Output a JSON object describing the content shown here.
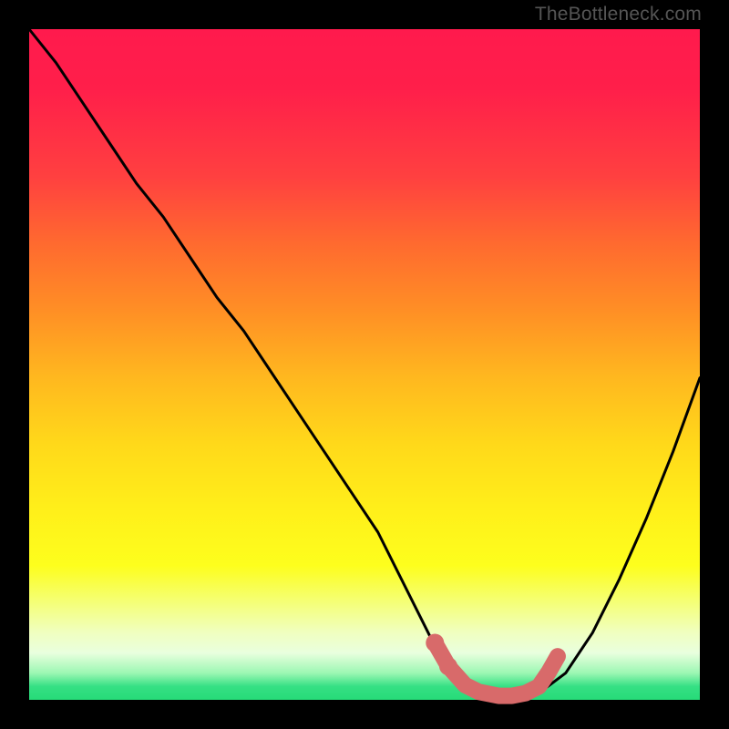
{
  "watermark": "TheBottleneck.com",
  "chart_data": {
    "type": "line",
    "title": "",
    "xlabel": "",
    "ylabel": "",
    "xlim": [
      0,
      100
    ],
    "ylim": [
      0,
      100
    ],
    "series": [
      {
        "name": "bottleneck-curve",
        "x": [
          0,
          4,
          8,
          12,
          16,
          20,
          24,
          28,
          32,
          36,
          40,
          44,
          48,
          52,
          55,
          58,
          61,
          64,
          67,
          70,
          73,
          76,
          80,
          84,
          88,
          92,
          96,
          100
        ],
        "y": [
          100,
          95,
          89,
          83,
          77,
          72,
          66,
          60,
          55,
          49,
          43,
          37,
          31,
          25,
          19,
          13,
          7,
          3,
          1,
          0.6,
          0.6,
          1,
          4,
          10,
          18,
          27,
          37,
          48
        ]
      },
      {
        "name": "highlight-band",
        "x": [
          60.5,
          62.5,
          65,
          67,
          70,
          72,
          74,
          76,
          77.5,
          78.8
        ],
        "y": [
          8.5,
          5,
          2.2,
          1.2,
          0.6,
          0.6,
          1,
          2,
          4.2,
          6.5
        ]
      }
    ],
    "colors": {
      "curve": "#000000",
      "highlight": "#d86a6a",
      "gradient_top": "#ff1a4d",
      "gradient_bottom": "#27db78"
    }
  }
}
